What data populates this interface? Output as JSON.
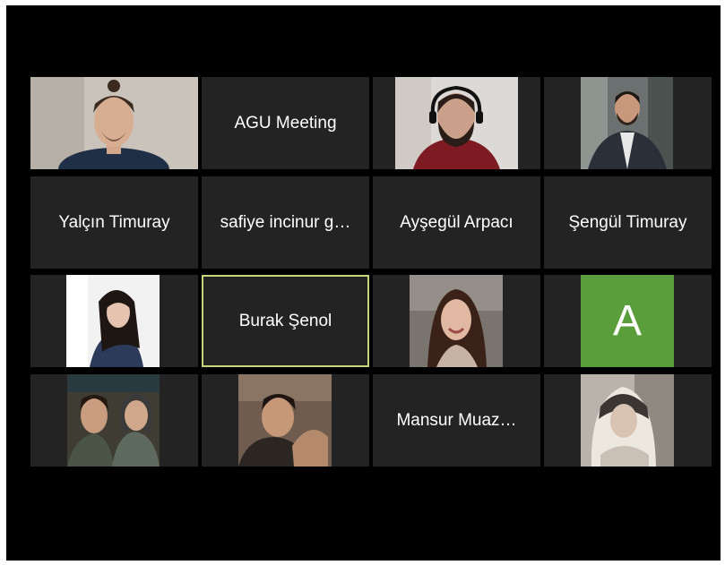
{
  "meeting": {
    "participants": [
      {
        "display": "video",
        "icon": "participant-video-man-bun"
      },
      {
        "display": "name",
        "name": "AGU Meeting"
      },
      {
        "display": "video",
        "icon": "participant-video-headphones"
      },
      {
        "display": "video",
        "icon": "participant-video-suit"
      },
      {
        "display": "name",
        "name": "Yalçın Timuray"
      },
      {
        "display": "name",
        "name": "safiye incinur g…"
      },
      {
        "display": "name",
        "name": "Ayşegül Arpacı"
      },
      {
        "display": "name",
        "name": "Şengül Timuray"
      },
      {
        "display": "video",
        "icon": "participant-photo-girl-long-hair"
      },
      {
        "display": "name",
        "name": "Burak Şenol",
        "active_speaker": true
      },
      {
        "display": "video",
        "icon": "participant-video-curly-hair"
      },
      {
        "display": "avatar",
        "letter": "A",
        "color": "#5a9e3c"
      },
      {
        "display": "video",
        "icon": "participant-photo-two-people"
      },
      {
        "display": "video",
        "icon": "participant-photo-young-man"
      },
      {
        "display": "name",
        "name": "Mansur Muaz…"
      },
      {
        "display": "video",
        "icon": "participant-photo-headscarf"
      }
    ]
  },
  "colors": {
    "tile_bg": "#232323",
    "active_border": "#c9d37a",
    "avatar_green": "#5a9e3c"
  }
}
